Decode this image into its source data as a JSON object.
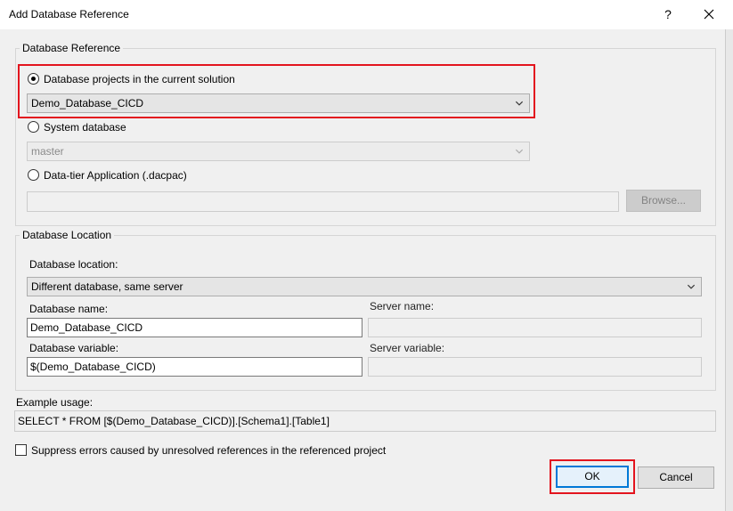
{
  "dialog": {
    "title": "Add Database Reference",
    "help_glyph": "?",
    "close_glyph": "✕"
  },
  "reference": {
    "legend": "Database Reference",
    "option_projects": {
      "label": "Database projects in the current solution",
      "selected": true,
      "value": "Demo_Database_CICD"
    },
    "option_system": {
      "label": "System database",
      "selected": false,
      "value": "master"
    },
    "option_dacpac": {
      "label": "Data-tier Application (.dacpac)",
      "selected": false,
      "value": "",
      "browse_label": "Browse..."
    }
  },
  "location": {
    "legend": "Database Location",
    "location_label": "Database location:",
    "location_value": "Different database, same server",
    "db_name_label": "Database name:",
    "db_name_value": "Demo_Database_CICD",
    "server_name_label": "Server name:",
    "server_name_value": "",
    "db_variable_label": "Database variable:",
    "db_variable_value": "$(Demo_Database_CICD)",
    "server_variable_label": "Server variable:",
    "server_variable_value": ""
  },
  "example": {
    "label": "Example usage:",
    "value": "SELECT * FROM [$(Demo_Database_CICD)].[Schema1].[Table1]"
  },
  "suppress": {
    "label": "Suppress errors caused by unresolved references in the referenced project",
    "checked": false
  },
  "buttons": {
    "ok": "OK",
    "cancel": "Cancel"
  },
  "colors": {
    "highlight": "#e3141e",
    "window_bg": "#f0f0f0"
  }
}
